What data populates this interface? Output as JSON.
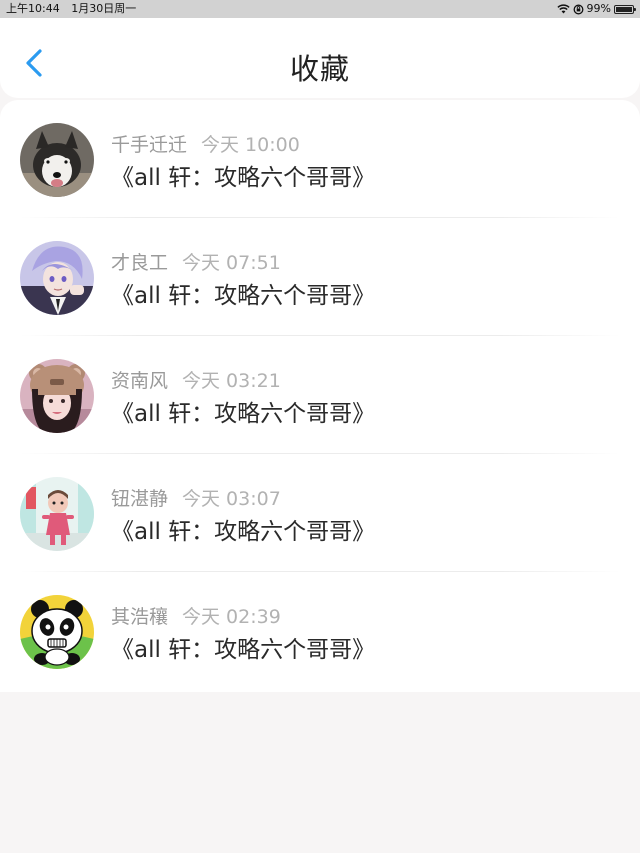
{
  "status_bar": {
    "time": "上午10:44",
    "date": "1月30日周一",
    "battery": "99%",
    "battery_level": 0.99,
    "icons": [
      "wifi-icon",
      "orientation-lock-icon",
      "battery-icon"
    ]
  },
  "nav": {
    "title": "收藏",
    "back_icon": "chevron-left-icon",
    "accent_color": "#2b9bf0"
  },
  "items": [
    {
      "name": "千手迁迁",
      "time": "今天 10:00",
      "content": "《all 轩：攻略六个哥哥》",
      "avatar": "husky-dog-avatar"
    },
    {
      "name": "才良工",
      "time": "今天 07:51",
      "content": "《all 轩：攻略六个哥哥》",
      "avatar": "anime-boy-avatar"
    },
    {
      "name": "资南风",
      "time": "今天 03:21",
      "content": "《all 轩：攻略六个哥哥》",
      "avatar": "girl-bear-hat-avatar"
    },
    {
      "name": "钮湛静",
      "time": "今天 03:07",
      "content": "《all 轩：攻略六个哥哥》",
      "avatar": "doll-toy-avatar"
    },
    {
      "name": "其浩穰",
      "time": "今天 02:39",
      "content": "《all 轩：攻略六个哥哥》",
      "avatar": "cartoon-panda-avatar"
    }
  ]
}
